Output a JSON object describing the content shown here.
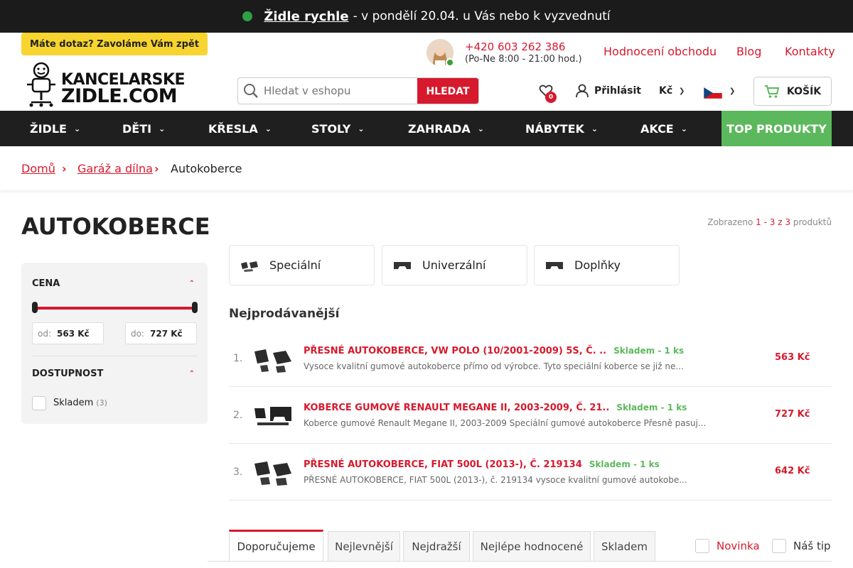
{
  "topbar": {
    "highlight": "Židle rychle",
    "rest": "- v pondělí 20.04. u Vás nebo k vyzvednutí"
  },
  "header": {
    "callback": "Máte dotaz? Zavoláme Vám zpět",
    "logo_line1": "KANCELARSKE",
    "logo_line2": "ZIDLE.COM",
    "phone": "+420 603 262 386",
    "hours": "(Po-Ne 8:00 - 21:00 hod.)",
    "links": [
      "Hodnocení obchodu",
      "Blog",
      "Kontakty"
    ],
    "search_placeholder": "Hledat v eshopu",
    "search_button": "HLEDAT",
    "favorites_count": "0",
    "login": "Přihlásit",
    "currency": "Kč",
    "cart": "KOŠÍK",
    "colors": {
      "accent": "#d7192d",
      "green": "#5cb85c",
      "yellow": "#f7d430"
    }
  },
  "nav": {
    "items": [
      "ŽIDLE",
      "DĚTI",
      "KŘESLA",
      "STOLY",
      "ZAHRADA",
      "NÁBYTEK",
      "AKCE"
    ],
    "top": "TOP PRODUKTY"
  },
  "breadcrumb": {
    "home": "Domů",
    "parent": "Garáž a dílna",
    "current": "Autokoberce"
  },
  "page": {
    "title": "AUTOKOBERCE",
    "shown_label": "Zobrazeno",
    "range_from": "1",
    "range_to": "3",
    "of": "z",
    "total": "3",
    "products_word": "produktů"
  },
  "filter": {
    "price_title": "CENA",
    "from_label": "od:",
    "from_value": "563 Kč",
    "to_label": "do:",
    "to_value": "727 Kč",
    "availability_title": "DOSTUPNOST",
    "stock_label": "Skladem",
    "stock_count": "(3)"
  },
  "categories": [
    "Speciální",
    "Univerzální",
    "Doplňky"
  ],
  "bestsellers": {
    "title": "Nejprodávanější",
    "items": [
      {
        "num": "1.",
        "name": "PŘESNÉ AUTOKOBERCE, VW POLO (10/2001-2009) 5S, Č. ..",
        "stock": "Skladem - 1 ks",
        "desc": "Vysoce kvalitní gumové autokoberce přímo od výrobce. Tyto speciální koberce se již ne...",
        "price": "563 Kč"
      },
      {
        "num": "2.",
        "name": "KOBERCE GUMOVÉ RENAULT MEGANE II, 2003-2009, Č. 21..",
        "stock": "Skladem - 1 ks",
        "desc": "Koberce gumové Renault Megane II, 2003-2009 Speciální gumové autokoberce Přesně pasuj...",
        "price": "727 Kč"
      },
      {
        "num": "3.",
        "name": "PŘESNÉ AUTOKOBERCE, FIAT 500L (2013-), Č. 219134",
        "stock": "Skladem - 1 ks",
        "desc": "PŘESNÉ AUTOKOBERCE, FIAT 500L (2013-), č. 219134 vysoce kvalitní gumové autokobe...",
        "price": "642 Kč"
      }
    ]
  },
  "sort": {
    "tabs": [
      "Doporučujeme",
      "Nejlevnější",
      "Nejdražší",
      "Nejlépe hodnocené",
      "Skladem"
    ],
    "checks": [
      "Novinka",
      "Náš tip"
    ]
  }
}
